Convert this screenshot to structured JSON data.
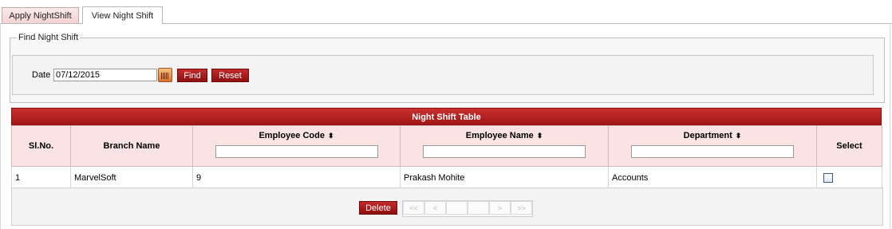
{
  "tabs": [
    {
      "label": "Apply NightShift",
      "active": false
    },
    {
      "label": "View Night Shift",
      "active": true
    }
  ],
  "find": {
    "legend": "Find Night Shift",
    "date_label": "Date",
    "date_value": "07/12/2015",
    "calendar_icon": "calendar-icon",
    "find_label": "Find",
    "reset_label": "Reset"
  },
  "table": {
    "title": "Night Shift Table",
    "columns": [
      {
        "label": "Sl.No.",
        "sortable": false,
        "filter": false
      },
      {
        "label": "Branch Name",
        "sortable": false,
        "filter": false
      },
      {
        "label": "Employee Code",
        "sortable": true,
        "filter": true
      },
      {
        "label": "Employee Name",
        "sortable": true,
        "filter": true
      },
      {
        "label": "Department",
        "sortable": true,
        "filter": true
      },
      {
        "label": "Select",
        "sortable": false,
        "filter": false
      }
    ],
    "rows": [
      {
        "sl": "1",
        "branch": "MarvelSoft",
        "code": "9",
        "name": "Prakash Mohite",
        "department": "Accounts",
        "selected": false
      }
    ],
    "sort_glyph": "⬍"
  },
  "footer": {
    "delete_label": "Delete",
    "pager": [
      "<<",
      "<",
      "",
      "",
      ">",
      ">>"
    ]
  },
  "colors": {
    "accent": "#b11f1f",
    "header_bg": "#fbe3e3",
    "tab_inactive": "#f4d2d2"
  }
}
